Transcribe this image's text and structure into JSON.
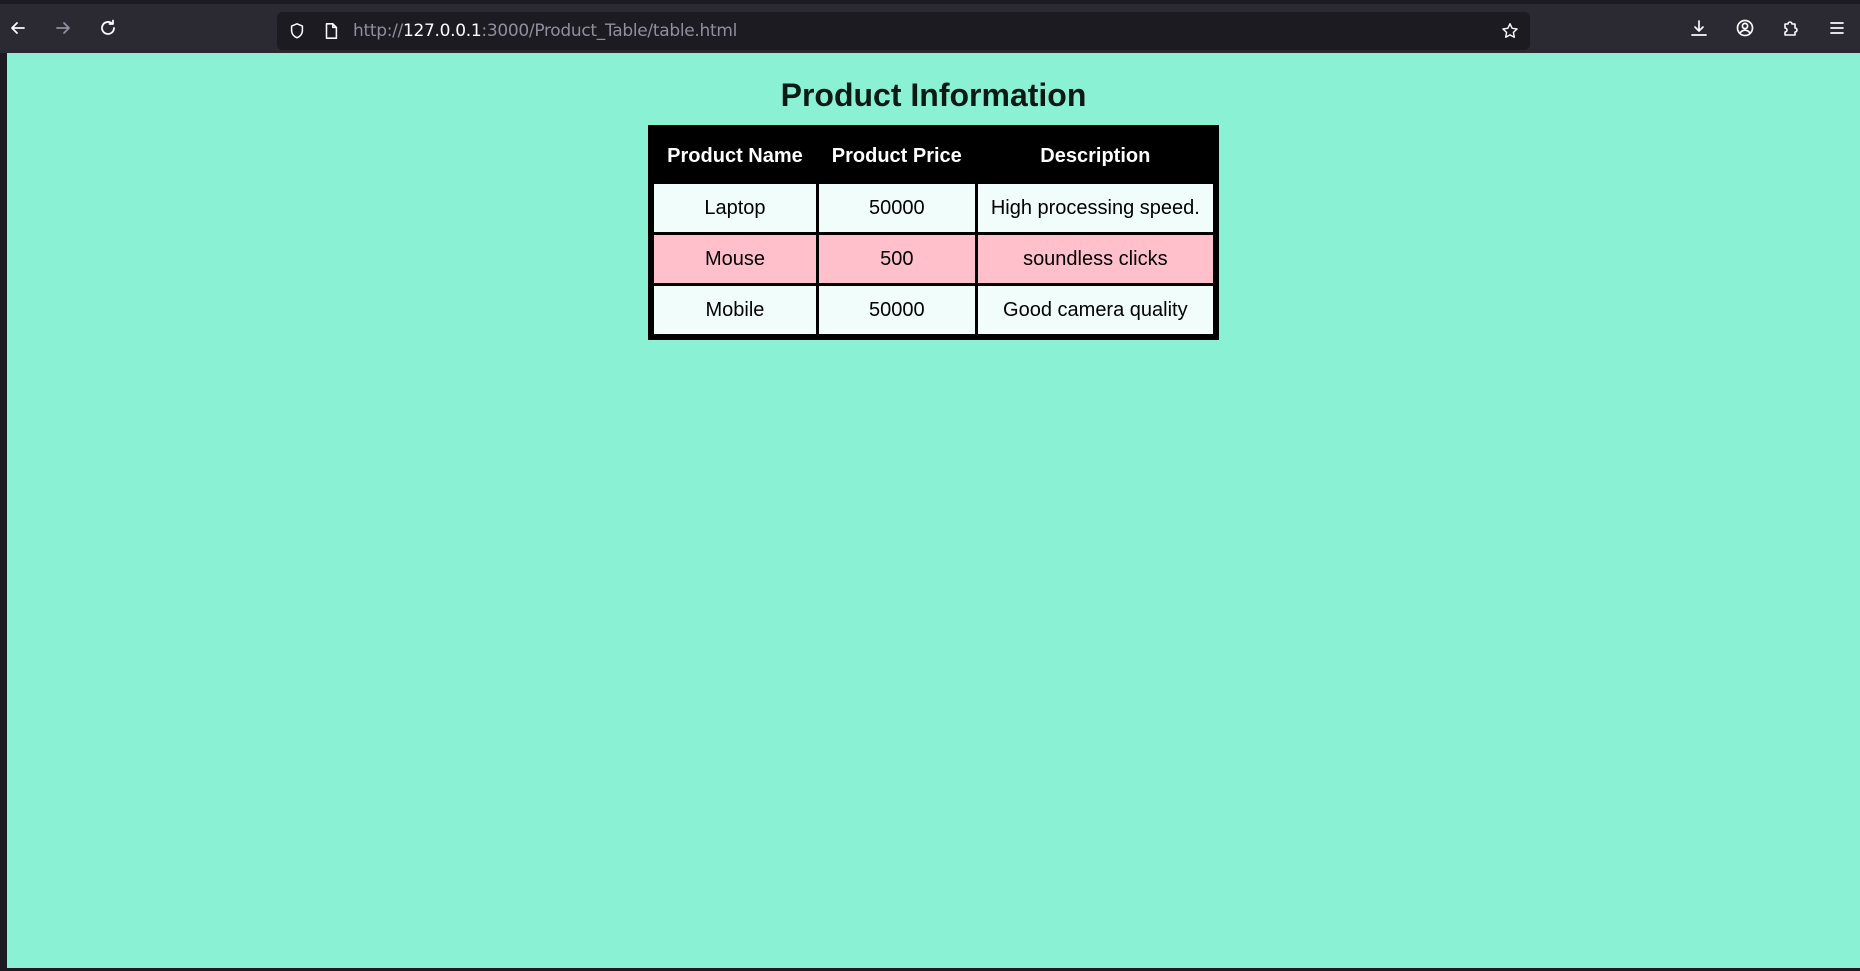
{
  "browser": {
    "url_prefix": "http://",
    "url_host": "127.0.0.1",
    "url_rest": ":3000/Product_Table/table.html"
  },
  "colors": {
    "page_background": "#8af1d4",
    "table_border": "#000000",
    "header_background": "#000000",
    "row_light": "#f0fdfb",
    "row_highlight": "#ffc0cb"
  },
  "page": {
    "title": "Product Information"
  },
  "table": {
    "headers": [
      "Product Name",
      "Product Price",
      "Description"
    ],
    "rows": [
      {
        "name": "Laptop",
        "price": "50000",
        "description": "High processing speed."
      },
      {
        "name": "Mouse",
        "price": "500",
        "description": "soundless clicks"
      },
      {
        "name": "Mobile",
        "price": "50000",
        "description": "Good camera quality"
      }
    ]
  }
}
